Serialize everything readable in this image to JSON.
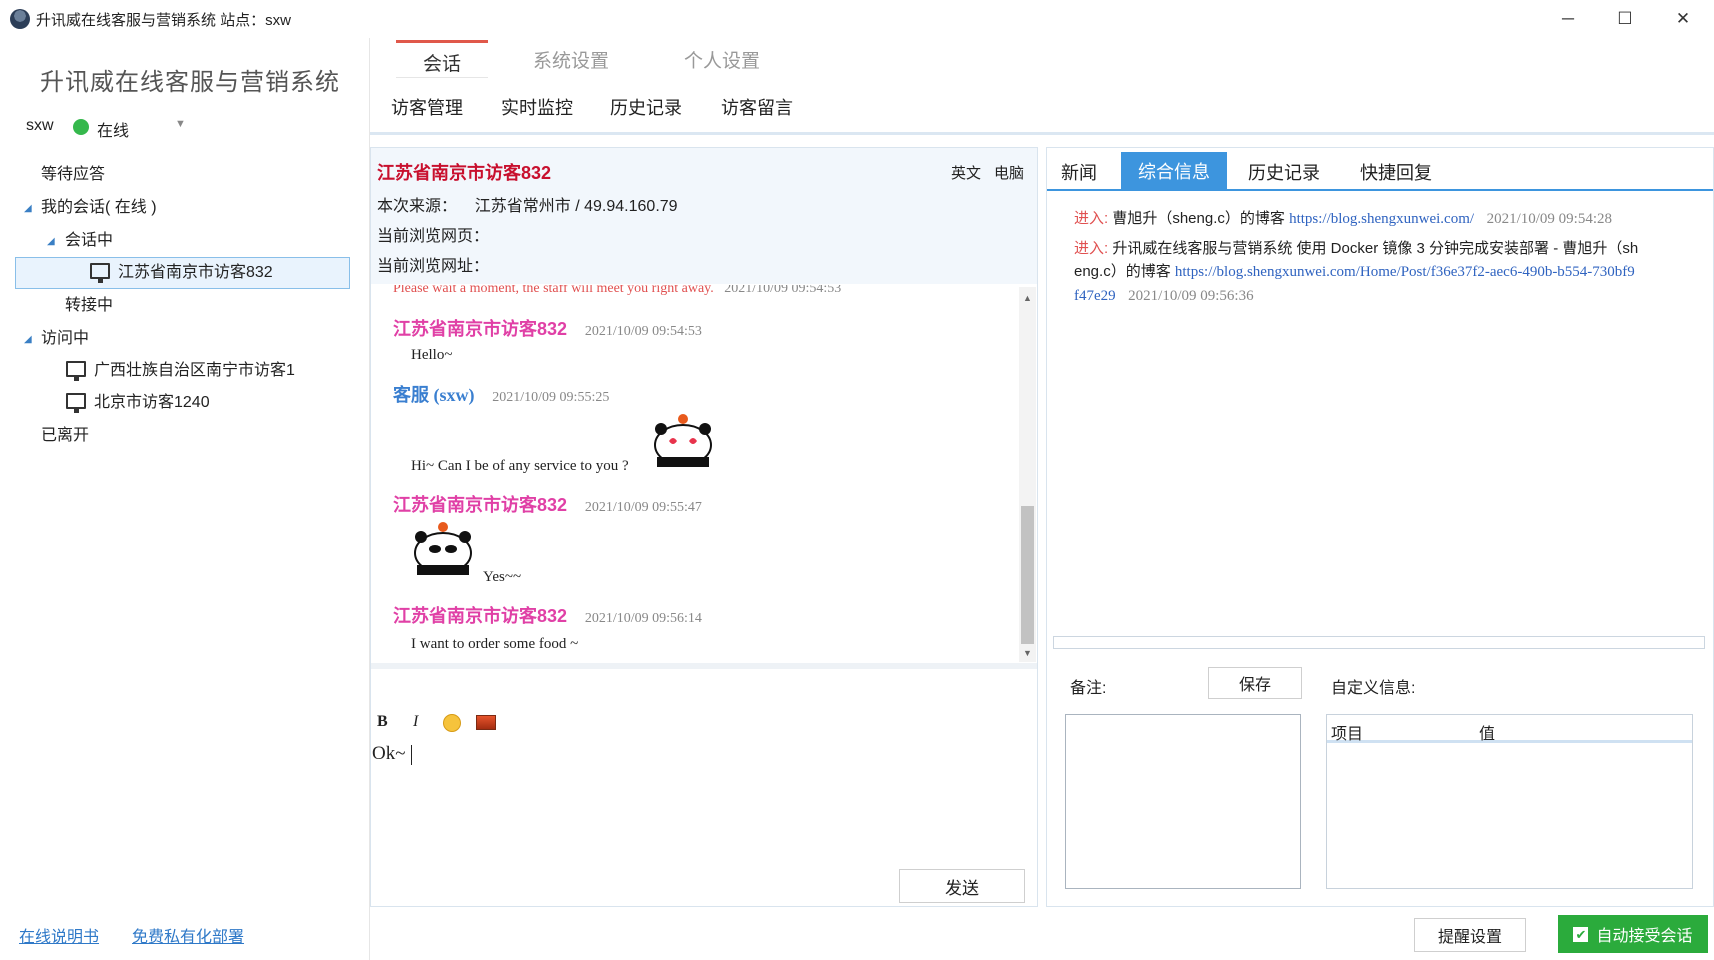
{
  "window": {
    "title": "升讯威在线客服与营销系统  站点：sxw",
    "minimize": "─",
    "maximize": "☐",
    "close": "✕"
  },
  "sidebar": {
    "brand": "升讯威在线客服与营销系统",
    "user": "sxw",
    "status": "在线",
    "status_color": "#35b84c",
    "tree": {
      "waiting": "等待应答",
      "my_sessions": "我的会话( 在线 )",
      "in_session": "会话中",
      "session_visitor": "江苏省南京市访客832",
      "transferring": "转接中",
      "visiting": "访问中",
      "visitor_1": "广西壮族自治区南宁市访客1",
      "visitor_2": "北京市访客1240",
      "left": "已离开"
    },
    "links": {
      "manual": "在线说明书",
      "deploy": "免费私有化部署"
    }
  },
  "top_tabs": {
    "chat": "会话",
    "system": "系统设置",
    "personal": "个人设置"
  },
  "sub_tabs": {
    "visitor_mgmt": "访客管理",
    "monitor": "实时监控",
    "history": "历史记录",
    "messages": "访客留言"
  },
  "visitor": {
    "name": "江苏省南京市访客832",
    "lang_tag": "英文",
    "device_tag": "电脑",
    "source_label": "本次来源：",
    "source_value": "江苏省常州市  /  49.94.160.79",
    "page_label": "当前浏览网页：",
    "url_label": "当前浏览网址："
  },
  "messages": [
    {
      "sys_text": "Please wait a moment, the staff will meet you right away.",
      "time": "2021/10/09 09:54:53"
    },
    {
      "name": "江苏省南京市访客832",
      "time": "2021/10/09 09:54:53",
      "text": "Hello~"
    },
    {
      "name": "客服 (sxw)",
      "time": "2021/10/09 09:55:25",
      "text": "Hi~ Can I be of any service to you ?"
    },
    {
      "name": "江苏省南京市访客832",
      "time": "2021/10/09 09:55:47",
      "text": "Yes~~"
    },
    {
      "name": "江苏省南京市访客832",
      "time": "2021/10/09 09:56:14",
      "text": "I want to order some food ~"
    }
  ],
  "editor": {
    "bold": "B",
    "italic": "I",
    "emoji_icon": "emoji-icon",
    "image_icon": "image-icon",
    "text": "Ok~",
    "send": "发送"
  },
  "right_tabs": {
    "news": "新闻",
    "info": "综合信息",
    "history": "历史记录",
    "quick": "快捷回复"
  },
  "visit_log": [
    {
      "enter": "进入:",
      "title": "曹旭升（sheng.c）的博客",
      "url": "https://blog.shengxunwei.com/",
      "time": "2021/10/09 09:54:28"
    },
    {
      "enter": "进入:",
      "title": "升讯威在线客服与营销系统 使用 Docker 镜像 3 分钟完成安装部署 - 曹旭升（sh",
      "title2": "eng.c）的博客",
      "url": "https://blog.shengxunwei.com/Home/Post/f36e37f2-aec6-490b-b554-730bf9",
      "url2": "f47e29",
      "time": "2021/10/09 09:56:36"
    }
  ],
  "notes": {
    "label": "备注:",
    "save": "保存"
  },
  "custom_info": {
    "label": "自定义信息:",
    "col_item": "项目",
    "col_value": "值"
  },
  "footer": {
    "remind": "提醒设置",
    "auto_accept": "自动接受会话",
    "auto_accept_checked": "✔"
  }
}
